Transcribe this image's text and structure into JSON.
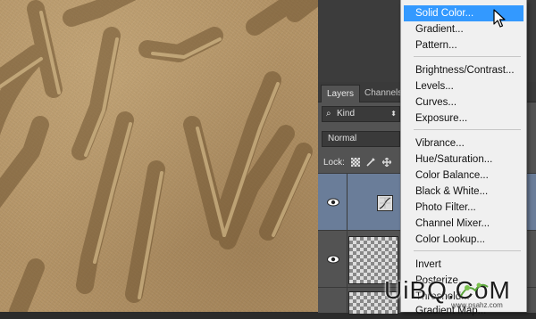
{
  "layers_panel": {
    "tabs": [
      "Layers",
      "Channels"
    ],
    "filter_label": "Kind",
    "blend_mode": "Normal",
    "lock_label": "Lock:"
  },
  "adjustment_menu": {
    "groups": [
      [
        "Solid Color...",
        "Gradient...",
        "Pattern..."
      ],
      [
        "Brightness/Contrast...",
        "Levels...",
        "Curves...",
        "Exposure..."
      ],
      [
        "Vibrance...",
        "Hue/Saturation...",
        "Color Balance...",
        "Black & White...",
        "Photo Filter...",
        "Channel Mixer...",
        "Color Lookup..."
      ],
      [
        "Invert",
        "Posterize...",
        "Threshold...",
        "Gradient Map..."
      ]
    ],
    "highlighted": "Solid Color..."
  },
  "watermark": {
    "logo": "UiBQ.CoM",
    "url": "www.psahz.com"
  },
  "colors": {
    "menu_highlight": "#3399ff",
    "selected_layer": "#6a7d99",
    "panel": "#535353",
    "sand": "#b89668"
  }
}
